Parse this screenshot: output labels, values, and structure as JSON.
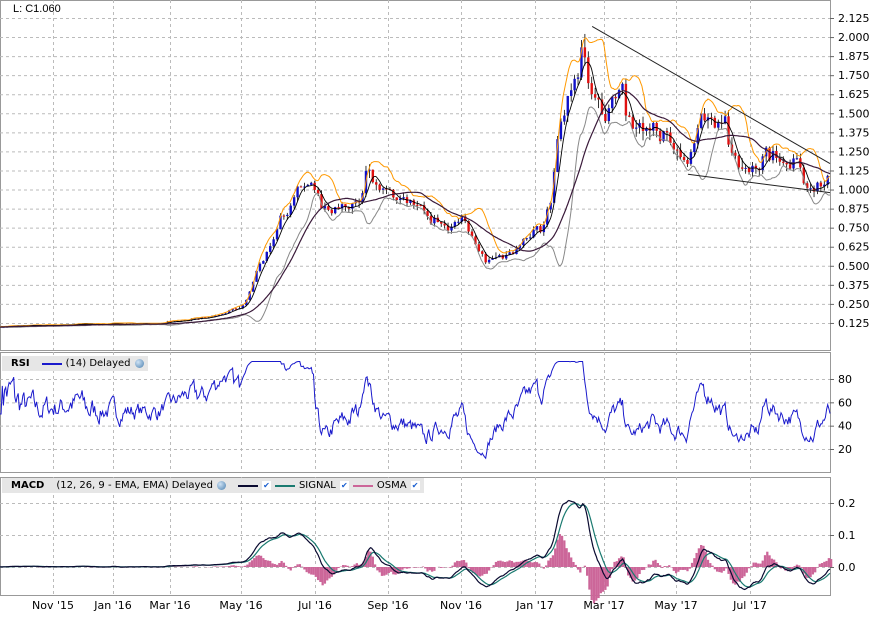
{
  "header": {
    "last_label": "L: C1.060"
  },
  "rsi_legend": {
    "title": "RSI",
    "params": "(14) Delayed"
  },
  "macd_legend": {
    "title": "MACD",
    "params": "(12, 26, 9 - EMA, EMA) Delayed",
    "signal": "SIGNAL",
    "osma": "OSMA"
  },
  "colors": {
    "up": "#1010c8",
    "down": "#e01010",
    "upper": "#ff9900",
    "lower": "#888888",
    "fast": "#000000",
    "slow": "#3a1a3a",
    "rsi": "#1a1acc",
    "macd": "#0a0a30",
    "signal": "#1a7a70",
    "osma": "#cc6699"
  },
  "chart_data": {
    "type": "candlestick",
    "x_unit": "weeks since mid-Sep 2015",
    "price_anchors": [
      [
        0,
        0.1
      ],
      [
        10,
        0.115
      ],
      [
        20,
        0.12
      ],
      [
        26,
        0.16
      ],
      [
        30,
        0.22
      ],
      [
        31,
        0.3
      ],
      [
        32,
        0.45
      ],
      [
        33,
        0.55
      ],
      [
        34,
        0.65
      ],
      [
        35,
        0.8
      ],
      [
        37,
        0.95
      ],
      [
        38,
        1.02
      ],
      [
        39,
        1.0
      ],
      [
        40,
        0.9
      ],
      [
        41,
        0.85
      ],
      [
        43,
        0.87
      ],
      [
        45,
        0.9
      ],
      [
        46,
        1.15
      ],
      [
        47,
        1.05
      ],
      [
        48,
        0.98
      ],
      [
        50,
        0.95
      ],
      [
        52,
        0.88
      ],
      [
        54,
        0.8
      ],
      [
        56,
        0.78
      ],
      [
        58,
        0.78
      ],
      [
        59,
        0.7
      ],
      [
        61,
        0.55
      ],
      [
        63,
        0.57
      ],
      [
        65,
        0.6
      ],
      [
        67,
        0.72
      ],
      [
        68,
        0.75
      ],
      [
        69,
        0.9
      ],
      [
        70,
        1.4
      ],
      [
        71,
        1.55
      ],
      [
        72,
        1.7
      ],
      [
        73,
        1.95
      ],
      [
        74,
        1.7
      ],
      [
        75,
        1.6
      ],
      [
        76,
        1.5
      ],
      [
        77,
        1.58
      ],
      [
        78,
        1.62
      ],
      [
        79,
        1.4
      ],
      [
        80,
        1.38
      ],
      [
        82,
        1.38
      ],
      [
        84,
        1.3
      ],
      [
        86,
        1.2
      ],
      [
        87,
        1.3
      ],
      [
        88,
        1.45
      ],
      [
        89,
        1.5
      ],
      [
        90,
        1.45
      ],
      [
        91,
        1.4
      ],
      [
        92,
        1.2
      ],
      [
        94,
        1.12
      ],
      [
        95,
        1.1
      ],
      [
        96,
        1.25
      ],
      [
        98,
        1.2
      ],
      [
        100,
        1.15
      ],
      [
        102,
        1.0
      ],
      [
        104,
        1.06
      ]
    ],
    "price_ticks": [
      "2.125",
      "2.000",
      "1.875",
      "1.750",
      "1.625",
      "1.500",
      "1.375",
      "1.250",
      "1.125",
      "1.000",
      "0.875",
      "0.750",
      "0.625",
      "0.500",
      "0.375",
      "0.250",
      "0.125"
    ],
    "price_range": [
      0.0,
      2.125
    ],
    "rsi_ticks": [
      "80",
      "60",
      "40",
      "20"
    ],
    "macd_ticks": [
      "0.2",
      "0.1",
      "0.0"
    ],
    "x_ticks": [
      "Nov '15",
      "Jan '16",
      "Mar '16",
      "May '16",
      "Jul '16",
      "Sep '16",
      "Nov '16",
      "Jan '17",
      "Mar '17",
      "May '17",
      "Jul '17"
    ],
    "trendlines": [
      [
        [
          74.2,
          2.07
        ],
        [
          104,
          1.17
        ]
      ],
      [
        [
          86.2,
          1.1
        ],
        [
          104,
          0.98
        ]
      ]
    ]
  }
}
